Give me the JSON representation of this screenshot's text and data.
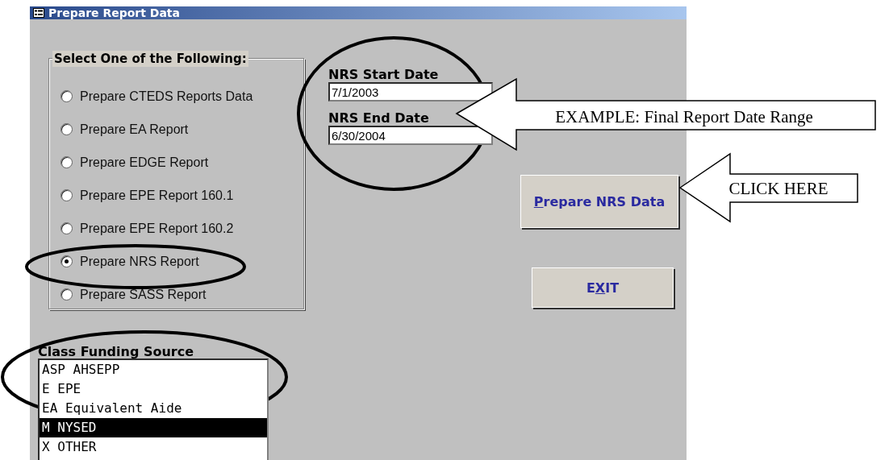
{
  "window": {
    "title": "Prepare Report Data"
  },
  "report_options": {
    "title": "Select One of the Following:",
    "options": [
      {
        "label": "Prepare CTEDS Reports Data",
        "selected": false
      },
      {
        "label": "Prepare EA Report",
        "selected": false
      },
      {
        "label": "Prepare EDGE Report",
        "selected": false
      },
      {
        "label": "Prepare EPE Report 160.1",
        "selected": false
      },
      {
        "label": "Prepare EPE Report 160.2",
        "selected": false
      },
      {
        "label": "Prepare NRS Report",
        "selected": true
      },
      {
        "label": "Prepare SASS Report",
        "selected": false
      }
    ]
  },
  "dates": [
    {
      "label": "NRS Start Date",
      "value": "7/1/2003"
    },
    {
      "label": "NRS End Date",
      "value": "6/30/2004"
    }
  ],
  "buttons": [
    {
      "key": "P",
      "after": "repare NRS Data"
    },
    {
      "before": "E",
      "key": "X",
      "after": "IT"
    }
  ],
  "funding_source": {
    "label": "Class Funding Source",
    "items": [
      {
        "label": "ASP AHSEPP",
        "selected": false
      },
      {
        "label": "E EPE",
        "selected": false
      },
      {
        "label": "EA Equivalent Aide",
        "selected": false
      },
      {
        "label": "M NYSED",
        "selected": true
      },
      {
        "label": "X OTHER",
        "selected": false
      }
    ]
  },
  "callouts": [
    {
      "text": "EXAMPLE: Final Report Date Range"
    },
    {
      "text": "CLICK HERE"
    }
  ]
}
